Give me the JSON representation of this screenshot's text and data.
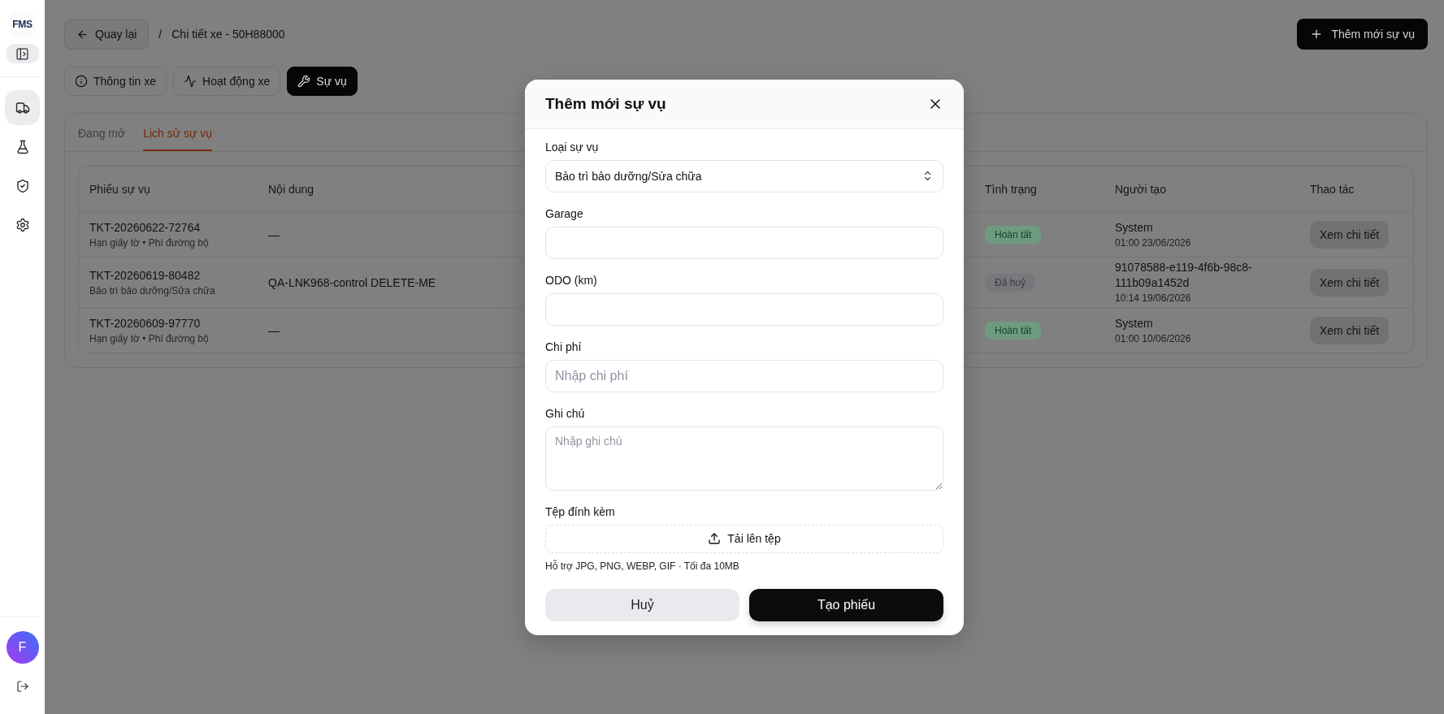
{
  "sidebar": {
    "logo": "FMS",
    "nav_items": [
      {
        "selected": true
      },
      {
        "selected": false
      },
      {
        "selected": false
      },
      {
        "selected": false
      }
    ],
    "avatar": "F"
  },
  "header": {
    "back_button": "Quay lại",
    "separator": "/",
    "breadcrumb": "Chi tiết xe - 50H88000",
    "add_button": "Thêm mới sự vụ"
  },
  "view_tabs": [
    {
      "label": "Thông tin xe",
      "selected": false
    },
    {
      "label": "Hoạt động xe",
      "selected": false
    },
    {
      "label": "Sự vụ",
      "selected": true
    }
  ],
  "sub_tabs": [
    {
      "label": "Đang mở",
      "selected": false
    },
    {
      "label": "Lịch sử sự vụ",
      "selected": true
    }
  ],
  "table": {
    "columns": [
      "Phiếu sự vụ",
      "Nội dung",
      "Tình trạng",
      "Người tạo",
      "Thao tác"
    ],
    "rows": [
      {
        "ticket": "TKT-20260622-72764",
        "category": "Hạn giấy tờ • Phí đường bộ",
        "content": "—",
        "status": {
          "label": "Hoàn tất",
          "kind": "done"
        },
        "creator": "System",
        "created_at": "01:00 23/06/2026",
        "action": "Xem chi tiết"
      },
      {
        "ticket": "TKT-20260619-80482",
        "category": "Bảo trì bảo dưỡng/Sửa chữa",
        "content": "QA-LNK968-control DELETE-ME",
        "status": {
          "label": "Đã huỷ",
          "kind": "cancelled"
        },
        "creator": "91078588-e119-4f6b-98c8-111b09a1452d",
        "created_at": "10:14 19/06/2026",
        "action": "Xem chi tiết"
      },
      {
        "ticket": "TKT-20260609-97770",
        "category": "Hạn giấy tờ • Phí đường bộ",
        "content": "—",
        "status": {
          "label": "Hoàn tất",
          "kind": "done"
        },
        "creator": "System",
        "created_at": "01:00 10/06/2026",
        "action": "Xem chi tiết"
      }
    ]
  },
  "modal": {
    "title": "Thêm mới sự vụ",
    "fields": [
      {
        "label": "Loại sự vụ",
        "kind": "select",
        "value": "Bảo trì bảo dưỡng/Sửa chữa"
      },
      {
        "label": "Garage",
        "kind": "input"
      },
      {
        "label": "ODO (km)",
        "kind": "input"
      },
      {
        "label": "Chi phí",
        "kind": "input",
        "placeholder": "Nhập chi phí"
      },
      {
        "label": "Ghi chú",
        "kind": "textarea",
        "placeholder": "Nhập ghi chú"
      },
      {
        "label": "Tệp đính kèm",
        "kind": "upload",
        "button": "Tải lên tệp",
        "hint": "Hỗ trợ JPG, PNG, WEBP, GIF · Tối đa 10MB"
      }
    ],
    "cancel_button": "Huỷ",
    "submit_button": "Tạo phiếu"
  }
}
